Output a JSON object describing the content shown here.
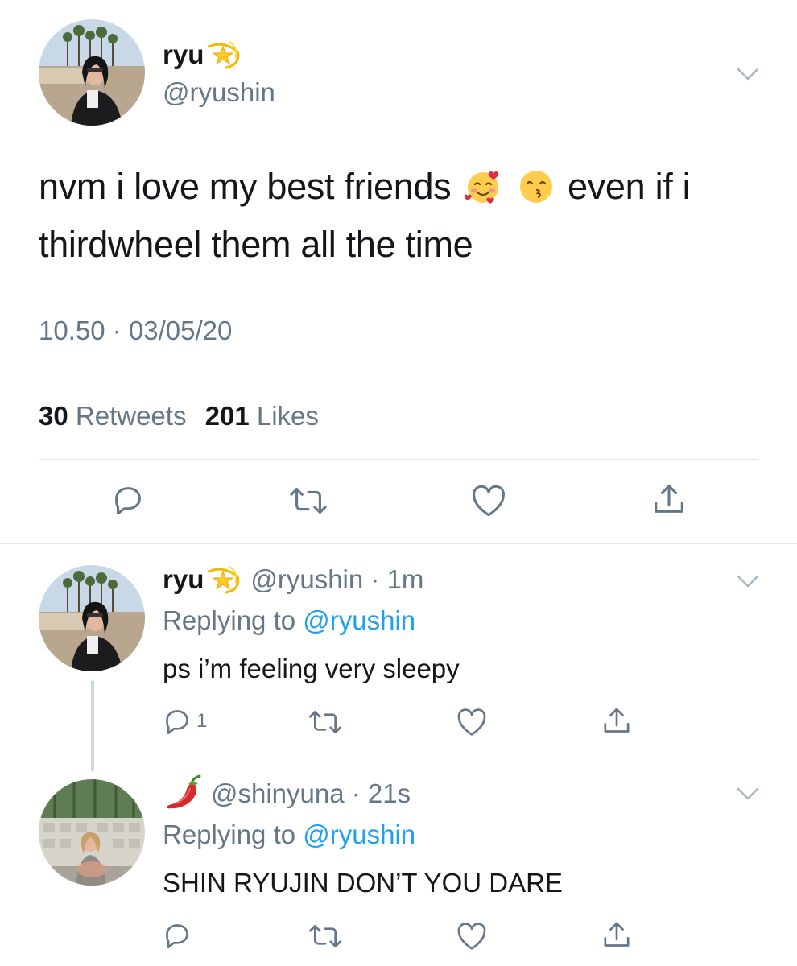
{
  "main_tweet": {
    "display_name": "ryu",
    "name_emoji": "dizzy-star-icon",
    "handle": "@ryushin",
    "text_part1": "nvm i love my best friends",
    "text_emojis": [
      "smiling-face-with-hearts-icon",
      "kissing-face-with-smiling-eyes-icon"
    ],
    "text_part2": "even if i thirdwheel them all the time",
    "timestamp": "10.50 · 03/05/20",
    "retweets_count": "30",
    "retweets_label": "Retweets",
    "likes_count": "201",
    "likes_label": "Likes"
  },
  "replies": [
    {
      "display_name": "ryu",
      "name_emoji": "dizzy-star-icon",
      "handle_time": "@ryushin · 1m",
      "replying_prefix": "Replying to",
      "replying_to": "@ryushin",
      "text": "ps i’m feeling very sleepy",
      "reply_count": "1"
    },
    {
      "display_name": "",
      "name_emoji": "hot-pepper-icon",
      "handle_time": "@shinyuna · 21s",
      "replying_prefix": "Replying to",
      "replying_to": "@ryushin",
      "text": "SHIN RYUJIN DON’T YOU DARE",
      "reply_count": ""
    }
  ],
  "colors": {
    "text": "#14171a",
    "secondary": "#657786",
    "link": "#1da1f2",
    "divider": "#e1e8ed",
    "thread_line": "#ccd6dd"
  }
}
